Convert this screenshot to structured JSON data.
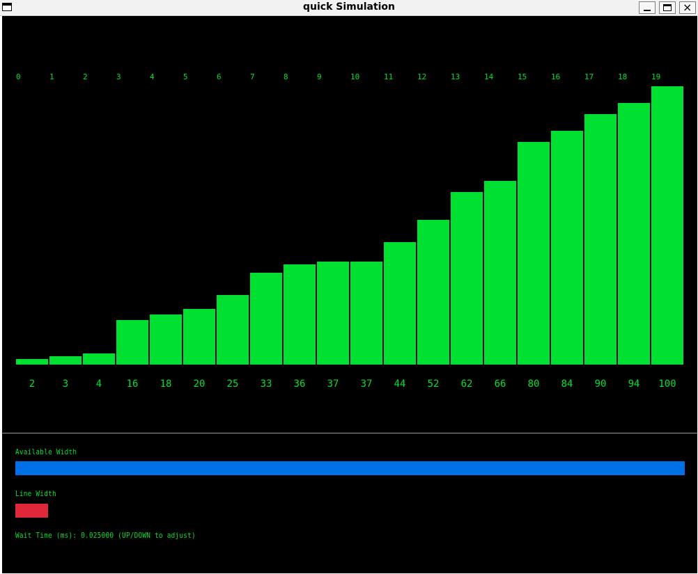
{
  "window": {
    "title": "quick Simulation",
    "close_symbol": "×"
  },
  "chart_data": {
    "type": "bar",
    "categories": [
      "0",
      "1",
      "2",
      "3",
      "4",
      "5",
      "6",
      "7",
      "8",
      "9",
      "10",
      "11",
      "12",
      "13",
      "14",
      "15",
      "16",
      "17",
      "18",
      "19"
    ],
    "values": [
      2,
      3,
      4,
      16,
      18,
      20,
      25,
      33,
      36,
      37,
      37,
      44,
      52,
      62,
      66,
      80,
      84,
      90,
      94,
      100
    ],
    "ylim": [
      0,
      100
    ],
    "bar_color": "#00e030",
    "grid": false
  },
  "controls": {
    "available_width_label": "Available Width",
    "available_width_color": "#0070e8",
    "line_width_label": "Line Width",
    "line_width_color": "#e0283a",
    "wait_time_text": "Wait Time (ms): 0.025000 (UP/DOWN to adjust)"
  },
  "theme": {
    "background": "#000000",
    "text_color": "#00e030"
  }
}
